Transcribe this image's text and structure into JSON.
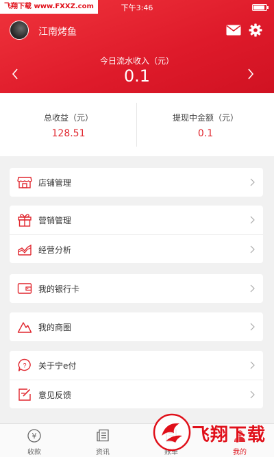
{
  "status_bar": {
    "time": "下午3:46",
    "watermark_left": "飞翔下载 www.FXXZ.com"
  },
  "header": {
    "shop_name": "江南烤鱼",
    "income_label": "今日流水收入（元）",
    "income_value": "0.1"
  },
  "stats": {
    "total_label": "总收益（元）",
    "total_value": "128.51",
    "withdraw_label": "提现中金额（元）",
    "withdraw_value": "0.1"
  },
  "menu": {
    "store": "店铺管理",
    "marketing": "营销管理",
    "analysis": "经营分析",
    "bank_card": "我的银行卡",
    "business_circle": "我的商圈",
    "about": "关于宁e付",
    "feedback": "意见反馈"
  },
  "tabs": {
    "collect": "收款",
    "news": "资讯",
    "bill": "账单",
    "mine": "我的"
  },
  "watermark": {
    "brand": "飞翔下载"
  },
  "colors": {
    "accent": "#e0262e",
    "header_red": "#de1a2a",
    "background": "#f1f1f1"
  }
}
